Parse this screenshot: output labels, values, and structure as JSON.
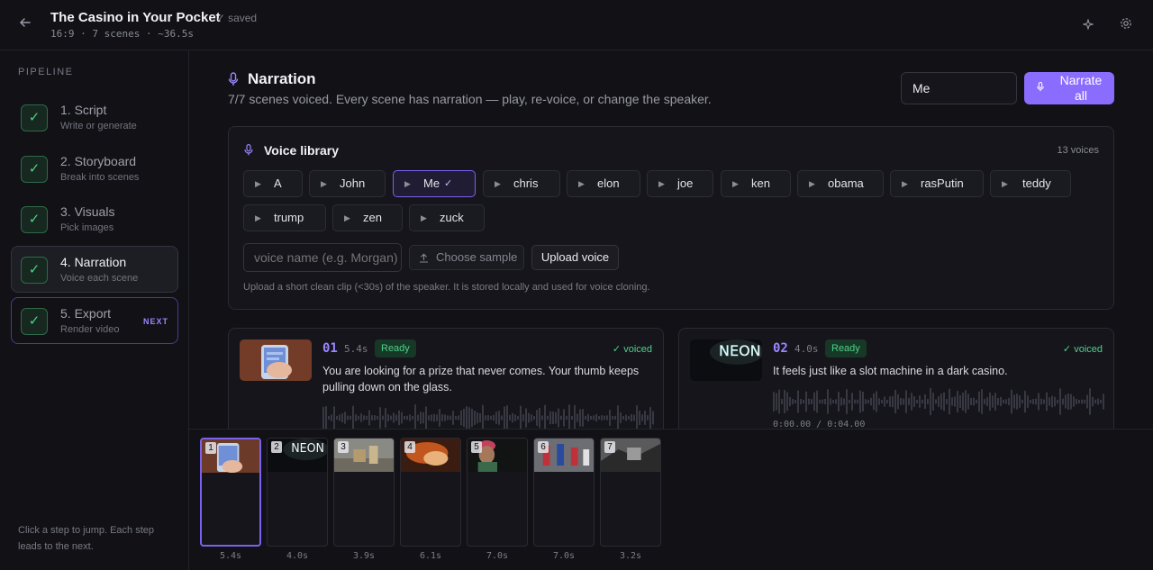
{
  "header": {
    "title": "The Casino in Your Pocket",
    "saved_label": "saved",
    "meta": "16:9  ·  7 scenes  ·  ~36.5s"
  },
  "sidebar": {
    "heading": "PIPELINE",
    "steps": [
      {
        "title": "1. Script",
        "sub": "Write or generate"
      },
      {
        "title": "2. Storyboard",
        "sub": "Break into scenes"
      },
      {
        "title": "3. Visuals",
        "sub": "Pick images"
      },
      {
        "title": "4. Narration",
        "sub": "Voice each scene"
      },
      {
        "title": "5. Export",
        "sub": "Render video",
        "badge": "NEXT"
      }
    ],
    "help": "Click a step to jump. Each step leads to the next."
  },
  "narration": {
    "title": "Narration",
    "description": "7/7 scenes voiced. Every scene has narration — play, re-voice, or change the speaker.",
    "speaker_value": "Me",
    "narrate_all_label": "Narrate all"
  },
  "voice_library": {
    "title": "Voice library",
    "count": "13 voices",
    "voices": [
      "A",
      "John",
      "Me",
      "chris",
      "elon",
      "joe",
      "ken",
      "obama",
      "rasPutin",
      "teddy",
      "trump",
      "zen",
      "zuck"
    ],
    "selected": "Me",
    "name_placeholder": "voice name (e.g. Morgan)",
    "choose_sample_label": "Choose sample",
    "upload_label": "Upload voice",
    "help": "Upload a short clean clip (<30s) of the speaker. It is stored locally and used for voice cloning."
  },
  "scenes": [
    {
      "num": "01",
      "duration": "5.4s",
      "status": "Ready",
      "voiced": "voiced",
      "text": "You are looking for a prize that never comes. Your thumb keeps pulling down on the glass."
    },
    {
      "num": "02",
      "duration": "4.0s",
      "status": "Ready",
      "voiced": "voiced",
      "text": "It feels just like a slot machine in a dark casino.",
      "time": "0:00.00 / 0:04.00"
    }
  ],
  "timeline": {
    "items": [
      {
        "num": "1",
        "duration": "5.4s"
      },
      {
        "num": "2",
        "duration": "4.0s"
      },
      {
        "num": "3",
        "duration": "3.9s"
      },
      {
        "num": "4",
        "duration": "6.1s"
      },
      {
        "num": "5",
        "duration": "7.0s"
      },
      {
        "num": "6",
        "duration": "7.0s"
      },
      {
        "num": "7",
        "duration": "3.2s"
      }
    ],
    "thumb_text_2": "NEON"
  },
  "colors": {
    "accent": "#8a6dff",
    "success": "#4fd08a",
    "background": "#111116"
  },
  "icons": [
    "back-arrow-icon",
    "sparkle-icon",
    "gear-icon",
    "check-icon",
    "microphone-icon",
    "play-icon",
    "upload-icon"
  ]
}
